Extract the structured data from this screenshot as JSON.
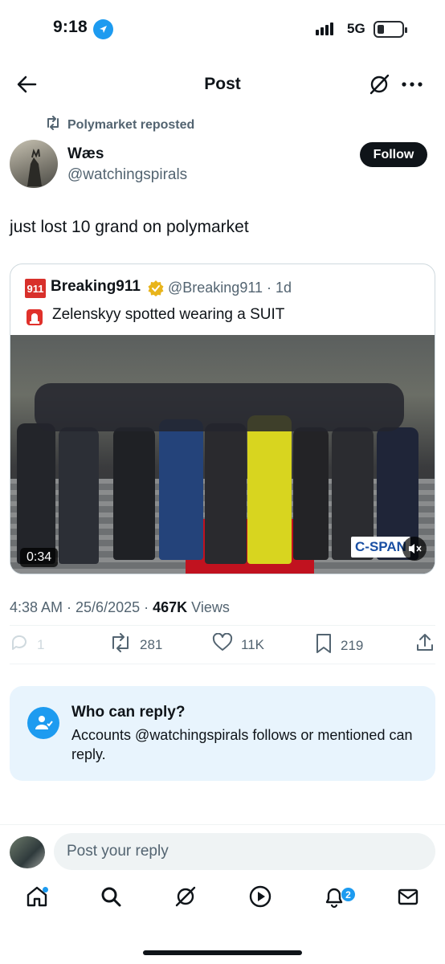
{
  "status_bar": {
    "time": "9:18",
    "network": "5G"
  },
  "header": {
    "title": "Post"
  },
  "repost": {
    "label": "Polymarket reposted"
  },
  "author": {
    "name": "Wæs",
    "handle": "@watchingspirals",
    "follow_label": "Follow"
  },
  "tweet": {
    "text": "just lost 10 grand on polymarket"
  },
  "quote": {
    "logo_text": "911",
    "name": "Breaking911",
    "handle_time": "@Breaking911 · 1d",
    "text": "Zelenskyy spotted wearing a SUIT",
    "video_duration": "0:34",
    "watermark": "C-SPAN"
  },
  "meta": {
    "time_date": "4:38 AM · 25/6/2025 · ",
    "views_count": "467K",
    "views_label": " Views"
  },
  "actions": {
    "replies": "1",
    "reposts": "281",
    "likes": "11K",
    "bookmarks": "219"
  },
  "who_can_reply": {
    "title": "Who can reply?",
    "text": "Accounts @watchingspirals follows or mentioned can reply."
  },
  "reply_box": {
    "placeholder": "Post your reply"
  },
  "tabbar": {
    "notifications_badge": "2"
  },
  "colors": {
    "accent": "#1d9bf0",
    "text": "#0f1419",
    "muted": "#536471"
  }
}
